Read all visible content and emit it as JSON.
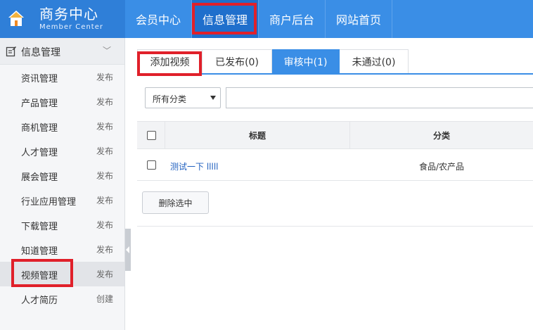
{
  "header": {
    "logo_title": "商务中心",
    "logo_subtitle": "Member Center",
    "nav": [
      "会员中心",
      "信息管理",
      "商户后台",
      "网站首页"
    ],
    "active_nav": "信息管理",
    "bg_color": "#3a8ee6"
  },
  "sidebar": {
    "section_label": "信息管理",
    "items": [
      {
        "label": "资讯管理",
        "action": "发布"
      },
      {
        "label": "产品管理",
        "action": "发布"
      },
      {
        "label": "商机管理",
        "action": "发布"
      },
      {
        "label": "人才管理",
        "action": "发布"
      },
      {
        "label": "展会管理",
        "action": "发布"
      },
      {
        "label": "行业应用管理",
        "action": "发布"
      },
      {
        "label": "下载管理",
        "action": "发布"
      },
      {
        "label": "知道管理",
        "action": "发布"
      },
      {
        "label": "视频管理",
        "action": "发布"
      },
      {
        "label": "人才简历",
        "action": "创建"
      }
    ],
    "active_item": "视频管理"
  },
  "tabs": {
    "items": [
      "添加视频",
      "已发布(0)",
      "审核中(1)",
      "未通过(0)"
    ],
    "active": "审核中(1)"
  },
  "filter": {
    "category_selected": "所有分类",
    "search_value": ""
  },
  "table": {
    "headers": {
      "title": "标题",
      "category": "分类"
    },
    "rows": [
      {
        "title": "测试一下 lllll",
        "category": "食品/农产品"
      }
    ]
  },
  "actions": {
    "delete_selected": "删除选中"
  },
  "highlight_color": "#e0202a"
}
